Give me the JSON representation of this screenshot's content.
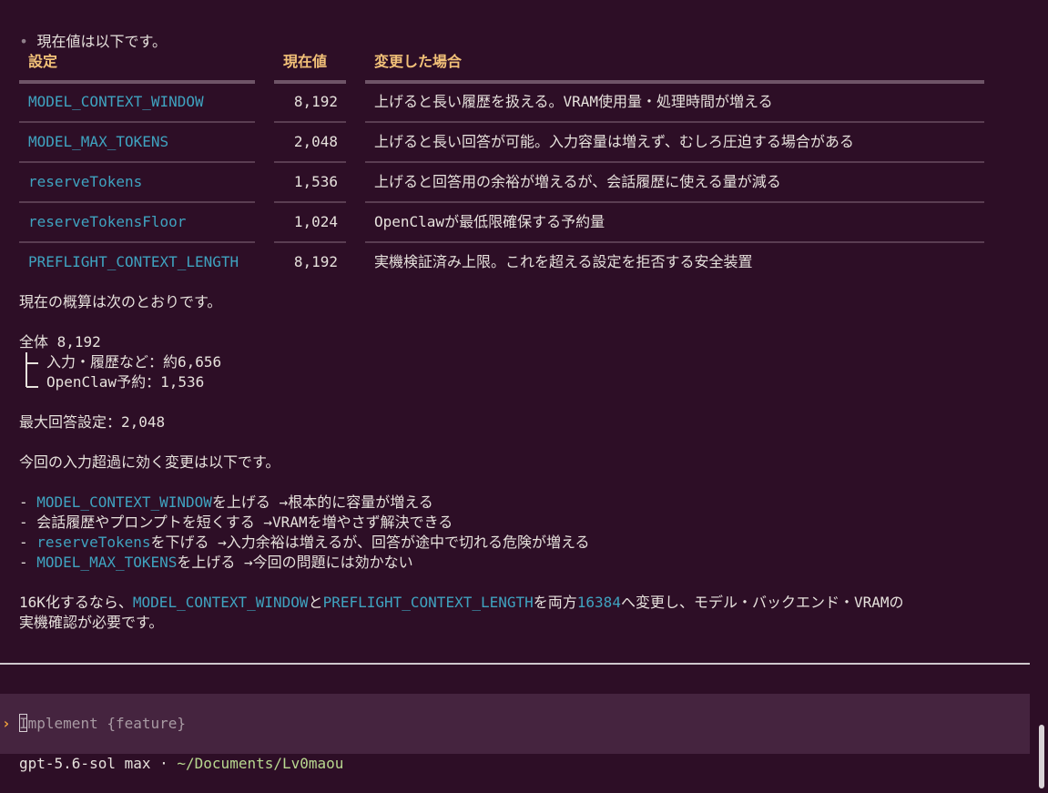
{
  "intro": "現在値は以下です。",
  "table": {
    "headers": {
      "setting": "設定",
      "current": "現在値",
      "effect": "変更した場合"
    },
    "rows": [
      {
        "setting": "MODEL_CONTEXT_WINDOW",
        "current": "8,192",
        "effect": "上げると長い履歴を扱える。VRAM使用量・処理時間が増える"
      },
      {
        "setting": "MODEL_MAX_TOKENS",
        "current": "2,048",
        "effect": "上げると長い回答が可能。入力容量は増えず、むしろ圧迫する場合がある"
      },
      {
        "setting": "reserveTokens",
        "current": "1,536",
        "effect": "上げると回答用の余裕が増えるが、会話履歴に使える量が減る"
      },
      {
        "setting": "reserveTokensFloor",
        "current": "1,024",
        "effect": "OpenClawが最低限確保する予約量"
      },
      {
        "setting": "PREFLIGHT_CONTEXT_LENGTH",
        "current": "8,192",
        "effect": "実機検証済み上限。これを超える設定を拒否する安全装置"
      }
    ]
  },
  "summary_intro": "現在の概算は次のとおりです。",
  "tree": {
    "total": "全体 8,192",
    "branch1": "入力・履歴など：約6,656",
    "branch2": "OpenClaw予約：1,536"
  },
  "max_answer": "最大回答設定：2,048",
  "changes_intro": "今回の入力超過に効く変更は以下です。",
  "changes": [
    {
      "code": "MODEL_CONTEXT_WINDOW",
      "pre": "",
      "text": "を上げる →根本的に容量が増える"
    },
    {
      "code": "",
      "pre": "会話履歴やプロンプトを短くする →VRAMを増やさず解決できる",
      "text": ""
    },
    {
      "code": "reserveTokens",
      "pre": "",
      "text": "を下げる →入力余裕は増えるが、回答が途中で切れる危険が増える"
    },
    {
      "code": "MODEL_MAX_TOKENS",
      "pre": "",
      "text": "を上げる →今回の問題には効かない"
    }
  ],
  "conclusion": {
    "prefix": "16K化するなら、",
    "code1": "MODEL_CONTEXT_WINDOW",
    "mid1": "と",
    "code2": "PREFLIGHT_CONTEXT_LENGTH",
    "mid2": "を両方",
    "code3": "16384",
    "suffix": "へ変更し、モデル・バックエンド・VRAMの",
    "line2": "実機確認が必要です。"
  },
  "input": {
    "prompt_symbol": "›",
    "first_char": "I",
    "placeholder_rest": "mplement {feature}"
  },
  "status": {
    "model": "gpt-5.6-sol max · ",
    "path": "~/Documents/Lv0maou"
  }
}
